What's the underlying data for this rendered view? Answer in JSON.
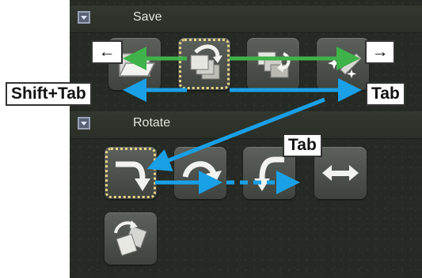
{
  "sections": {
    "save": {
      "title": "Save"
    },
    "rotate": {
      "title": "Rotate"
    }
  },
  "labels": {
    "left_arrow": "←",
    "right_arrow": "→",
    "shift_tab": "Shift+Tab",
    "tab_right": "Tab",
    "tab_rotate": "Tab"
  },
  "colors": {
    "green_arrow": "#3fb24a",
    "blue_arrow": "#1aa0e6",
    "focus_outline": "#e6d48a"
  },
  "icons": [
    "open-folder-icon",
    "save-stack-icon",
    "save-restore-icon",
    "sparkle-icon",
    "rotate-cw-icon",
    "rotate-arc-icon",
    "rotate-ccw-icon",
    "flip-horizontal-icon",
    "rotate-pages-icon"
  ]
}
